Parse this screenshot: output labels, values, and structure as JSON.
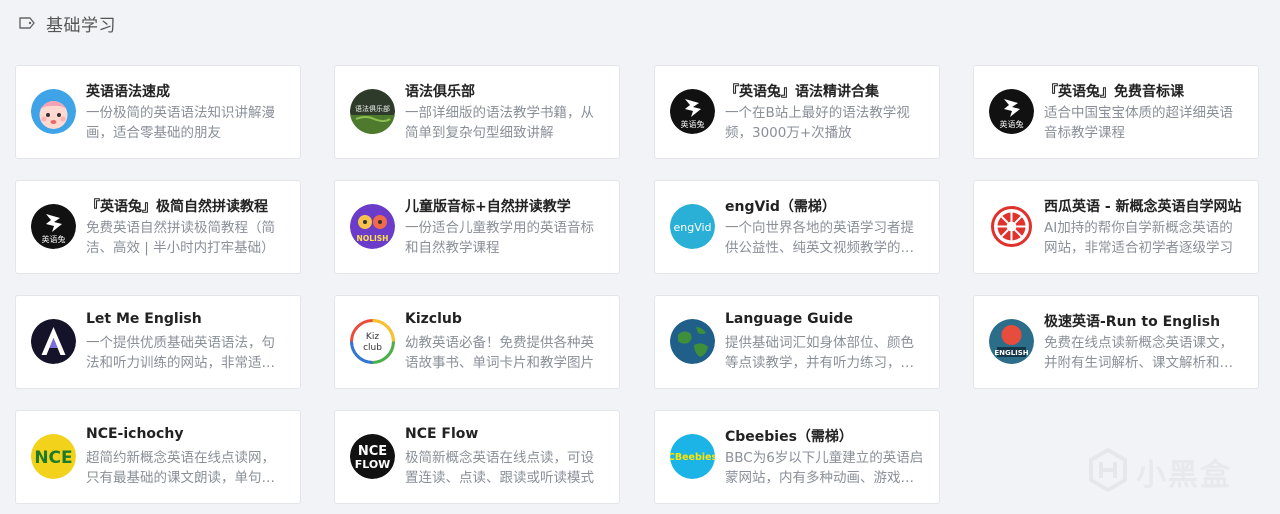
{
  "section": {
    "title": "基础学习",
    "icon": "tag-icon"
  },
  "cards": [
    {
      "name": "英语语法速成",
      "desc": "一份极简的英语语法知识讲解漫画，适合零基础的朋友",
      "icon": "cartoon-baby-logo"
    },
    {
      "name": "语法俱乐部",
      "desc": "一部详细版的语法教学书籍，从简单到复杂句型细致讲解",
      "icon": "grammar-club-logo",
      "logo_text": "语法俱乐部"
    },
    {
      "name": "『英语兔』语法精讲合集",
      "desc": "一个在B站上最好的语法教学视频，3000万+次播放",
      "icon": "english-rabbit-logo",
      "logo_text": "英语兔"
    },
    {
      "name": "『英语兔』免费音标课",
      "desc": "适合中国宝宝体质的超详细英语音标教学课程",
      "icon": "english-rabbit-logo",
      "logo_text": "英语兔"
    },
    {
      "name": "『英语兔』极简自然拼读教程",
      "desc": "免费英语自然拼读极简教程（简洁、高效 | 半小时内打牢基础）",
      "icon": "english-rabbit-logo",
      "logo_text": "英语兔"
    },
    {
      "name": "儿童版音标+自然拼读教学",
      "desc": "一份适合儿童教学用的英语音标和自然教学课程",
      "icon": "kids-phonics-logo",
      "logo_text": "NOLISH"
    },
    {
      "name": "engVid（需梯）",
      "desc": "一个向世界各地的英语学习者提供公益性、纯英文视频教学的网站",
      "icon": "engvid-logo",
      "logo_text": "engVid"
    },
    {
      "name": "西瓜英语 - 新概念英语自学网站",
      "desc": "AI加持的帮你自学新概念英语的网站，非常适合初学者逐级学习",
      "icon": "watermelon-logo"
    },
    {
      "name": "Let Me English",
      "desc": "一个提供优质基础英语语法，句法和听力训练的网站，非常适合入门",
      "icon": "let-me-english-logo"
    },
    {
      "name": "Kizclub",
      "desc": "幼教英语必备！免费提供各种英语故事书、单词卡片和教学图片",
      "icon": "kizclub-logo",
      "logo_text": "Kiz club"
    },
    {
      "name": "Language Guide",
      "desc": "提供基础词汇如身体部位、颜色等点读教学，并有听力练习，适合入门",
      "icon": "globe-logo"
    },
    {
      "name": "极速英语-Run to English",
      "desc": "免费在线点读新概念英语课文，并附有生词解析、课文解析和翻译",
      "icon": "run-to-english-logo",
      "logo_text": "ENGLISH"
    },
    {
      "name": "NCE-ichochy",
      "desc": "超简约新概念英语在线点读网，只有最基础的课文朗读，单句复读",
      "icon": "nce-ichochy-logo",
      "logo_text": "NCE"
    },
    {
      "name": "NCE Flow",
      "desc": "极简新概念英语在线点读，可设置连读、点读、跟读或听读模式",
      "icon": "nce-flow-logo",
      "logo_text": "NCE FLOW"
    },
    {
      "name": "Cbeebies（需梯）",
      "desc": "BBC为6岁以下儿童建立的英语启蒙网站，内有多种动画、游戏资源",
      "icon": "cbeebies-logo",
      "logo_text": "CBeebies"
    }
  ],
  "watermark": {
    "text": "小黑盒",
    "icon": "heybox-logo"
  },
  "colors": {
    "background": "#f1f3f6",
    "card": "#ffffff",
    "title": "#222222",
    "desc": "#8a8f98"
  }
}
